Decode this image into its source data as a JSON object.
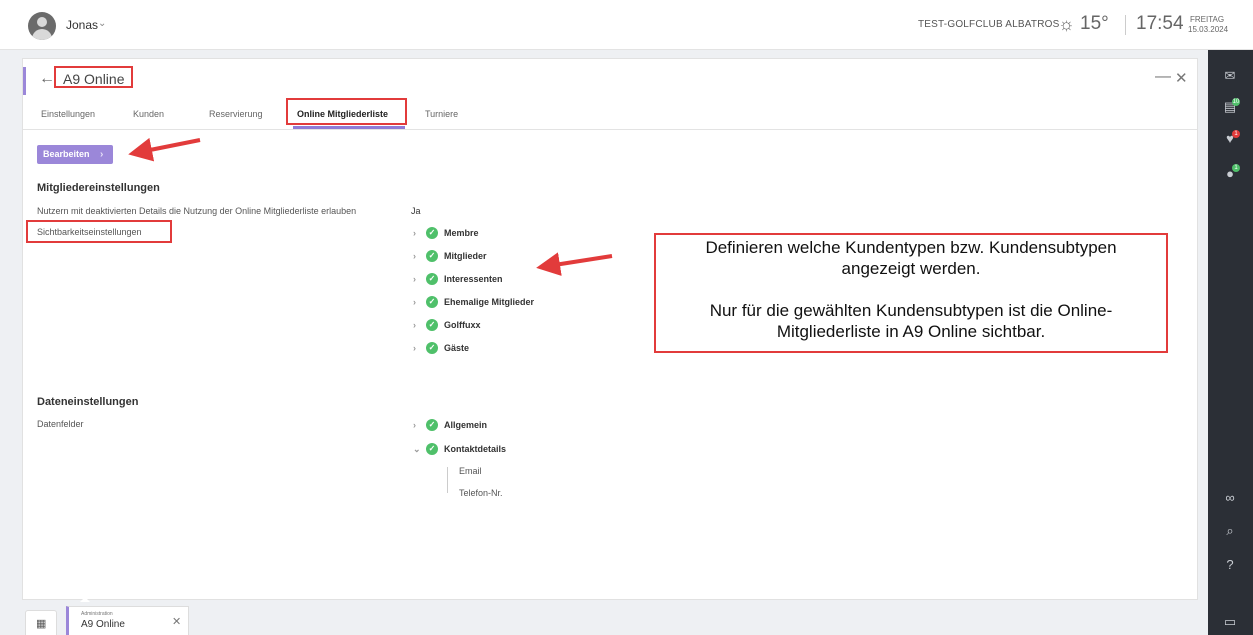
{
  "header": {
    "user_name": "Jonas",
    "user_caret": "⌄",
    "club_name": "TEST-GOLFCLUB ALBATROS",
    "temperature": "15°",
    "time": "17:54",
    "weekday": "FREITAG",
    "date": "15.03.2024",
    "icons": [
      "avatar",
      "sun-icon"
    ]
  },
  "panel": {
    "title": "A9 Online",
    "tabs": [
      {
        "label": "Einstellungen"
      },
      {
        "label": "Kunden"
      },
      {
        "label": "Reservierung"
      },
      {
        "label": "Online Mitgliederliste",
        "active": true
      },
      {
        "label": "Turniere"
      }
    ],
    "edit_button": "Bearbeiten",
    "member_settings": {
      "title": "Mitgliedereinstellungen",
      "allow_label": "Nutzern mit deaktivierten Details die Nutzung der Online Mitgliederliste erlauben",
      "allow_value": "Ja",
      "visibility_label": "Sichtbarkeitseinstellungen",
      "visibility_items": [
        "Membre",
        "Mitglieder",
        "Interessenten",
        "Ehemalige Mitglieder",
        "Golffuxx",
        "Gäste"
      ]
    },
    "data_settings": {
      "title": "Dateneinstellungen",
      "fields_label": "Datenfelder",
      "field_groups": [
        "Allgemein",
        "Kontaktdetails"
      ],
      "contact_subfields": [
        "Email",
        "Telefon-Nr."
      ]
    }
  },
  "annotation": {
    "line1": "Definieren welche Kundentypen bzw. Kundensubtypen",
    "line2": "angezeigt werden.",
    "line3": "Nur für die gewählten Kundensubtypen ist die Online-",
    "line4": "Mitgliederliste in A9 Online sichtbar.",
    "accent_color": "#e23b3b"
  },
  "sidebar_right": {
    "badges": [
      "10",
      "1",
      "1"
    ],
    "icons": [
      "mail-icon",
      "clipboard-icon",
      "heart-icon",
      "coin-icon",
      "glasses-icon",
      "search-icon",
      "help-icon",
      "window-icon"
    ]
  },
  "taskbar": {
    "tab_category": "Administration",
    "tab_title": "A9 Online"
  },
  "colors": {
    "accent": "#9b87d9",
    "check_green": "#4fc06a",
    "sidebar_dark": "#2b2f36"
  }
}
